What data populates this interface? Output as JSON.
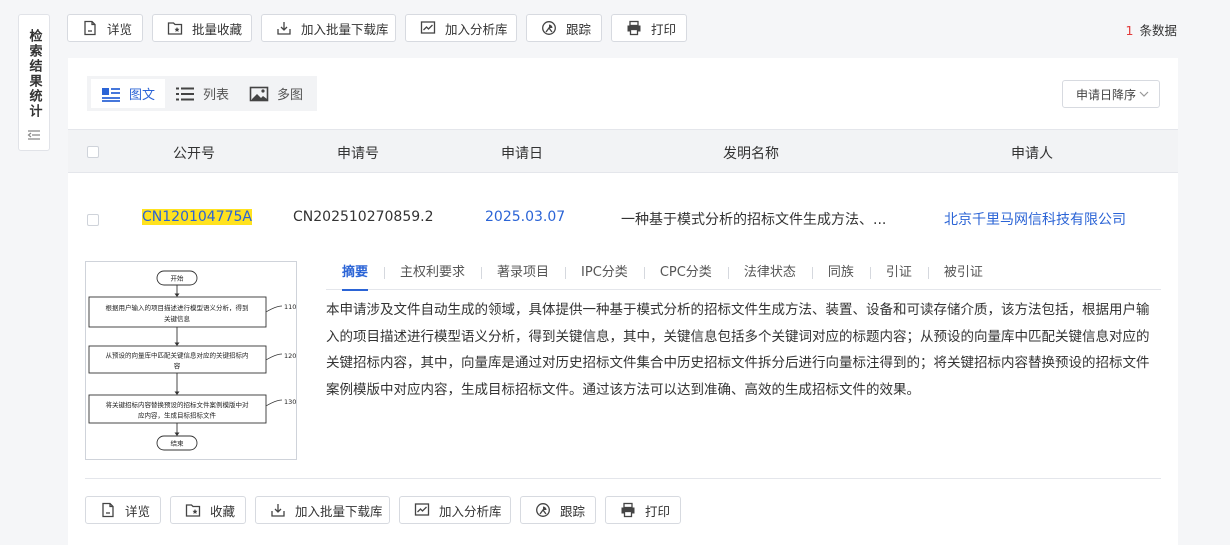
{
  "side_panel": {
    "label": "检索结果统计",
    "icon": "collapse-icon"
  },
  "toolbar": [
    {
      "label": "详览",
      "icon": "document-icon"
    },
    {
      "label": "批量收藏",
      "icon": "star-folder-icon"
    },
    {
      "label": "加入批量下载库",
      "icon": "download-icon"
    },
    {
      "label": "加入分析库",
      "icon": "chart-icon"
    },
    {
      "label": "跟踪",
      "icon": "track-icon"
    },
    {
      "label": "打印",
      "icon": "printer-icon"
    }
  ],
  "result_count": {
    "number": "1",
    "suffix": "条数据"
  },
  "view_tabs": [
    {
      "label": "图文",
      "icon": "picture-text-icon",
      "active": true
    },
    {
      "label": "列表",
      "icon": "list-icon",
      "active": false
    },
    {
      "label": "多图",
      "icon": "image-icon",
      "active": false
    }
  ],
  "sort": {
    "label": "申请日降序"
  },
  "table": {
    "headers": [
      "公开号",
      "申请号",
      "申请日",
      "发明名称",
      "申请人"
    ],
    "row": {
      "pub_no": "CN120104775A",
      "app_no": "CN202510270859.2",
      "app_date": "2025.03.07",
      "title": "一种基于模式分析的招标文件生成方法、...",
      "applicant": "北京千里马网信科技有限公司"
    }
  },
  "thumbnail": {
    "start": "开始",
    "end": "结束",
    "steps": [
      {
        "text1": "根据用户输入的项目描述进行模型语义分析，得到",
        "text2": "关键信息",
        "num": "110"
      },
      {
        "text1": "从预设的向量库中匹配关键信息对应的关键招标内",
        "text2": "容",
        "num": "120"
      },
      {
        "text1": "将关键招标内容替换预设的招标文件案例模版中对",
        "text2": "应内容，生成目标招标文件",
        "num": "130"
      }
    ]
  },
  "info_tabs": [
    "摘要",
    "主权利要求",
    "著录项目",
    "IPC分类",
    "CPC分类",
    "法律状态",
    "同族",
    "引证",
    "被引证"
  ],
  "abstract": "本申请涉及文件自动生成的领域，具体提供一种基于模式分析的招标文件生成方法、装置、设备和可读存储介质，该方法包括，根据用户输入的项目描述进行模型语义分析，得到关键信息，其中，关键信息包括多个关键词对应的标题内容；从预设的向量库中匹配关键信息对应的关键招标内容，其中，向量库是通过对历史招标文件集合中历史招标文件拆分后进行向量标注得到的；将关键招标内容替换预设的招标文件案例模版中对应内容，生成目标招标文件。通过该方法可以达到准确、高效的生成招标文件的效果。",
  "bottom_toolbar": [
    {
      "label": "详览",
      "icon": "document-icon"
    },
    {
      "label": "收藏",
      "icon": "star-folder-icon"
    },
    {
      "label": "加入批量下载库",
      "icon": "download-icon"
    },
    {
      "label": "加入分析库",
      "icon": "chart-icon"
    },
    {
      "label": "跟踪",
      "icon": "track-icon"
    },
    {
      "label": "打印",
      "icon": "printer-icon"
    }
  ]
}
